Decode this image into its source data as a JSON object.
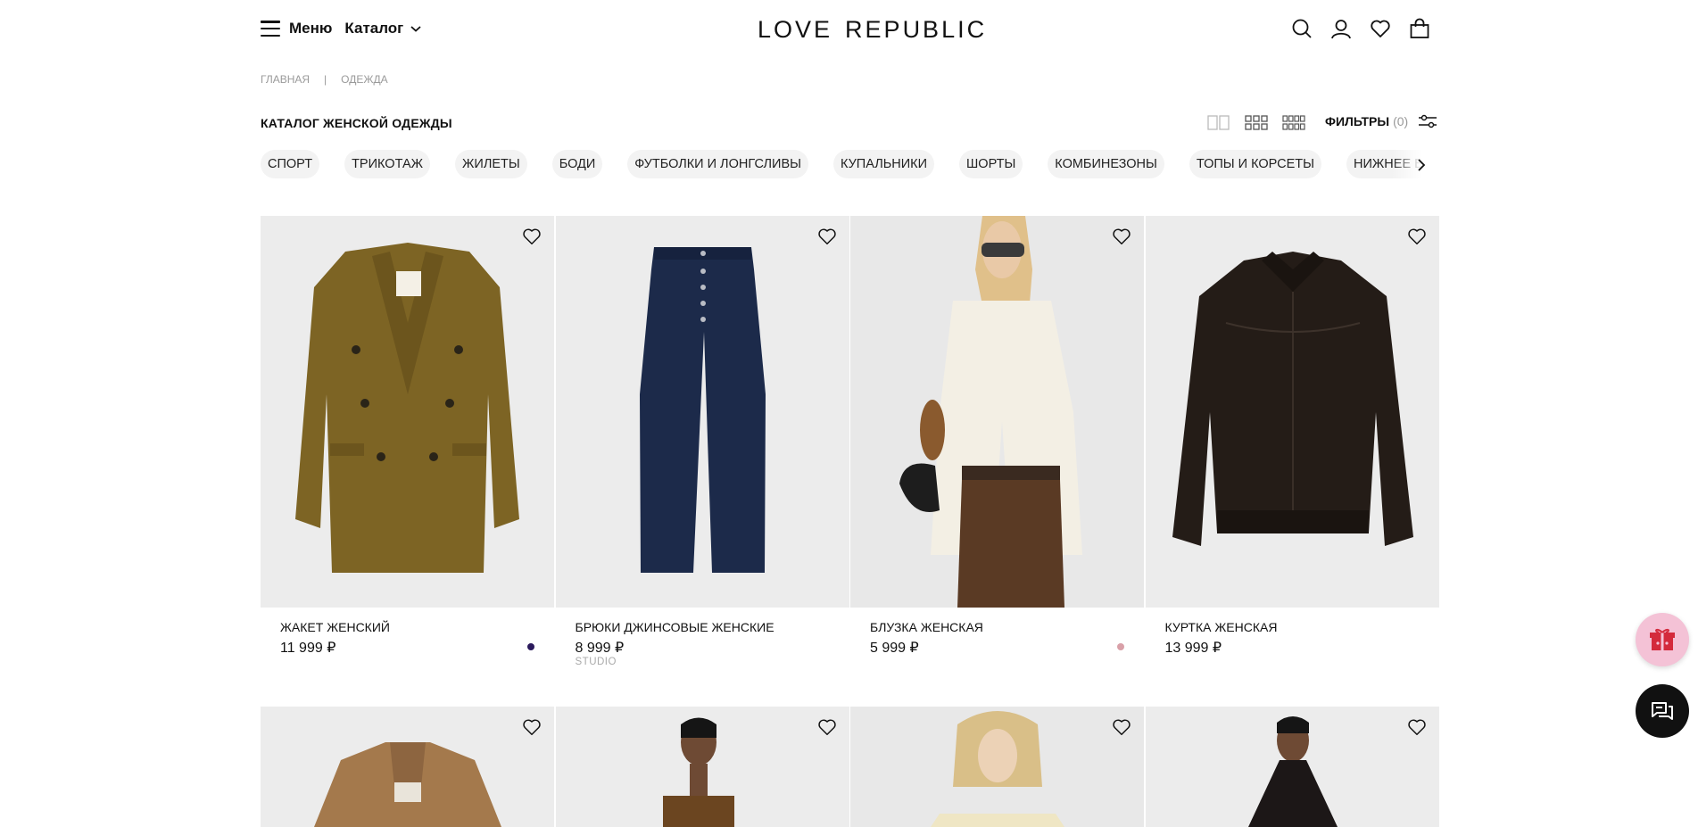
{
  "header": {
    "menu_label": "Меню",
    "catalog_label": "Каталог",
    "logo_left": "LOVE",
    "logo_right": "REPUBLIC",
    "icons": [
      "search-icon",
      "user-icon",
      "heart-icon",
      "bag-icon"
    ]
  },
  "breadcrumb": {
    "home": "ГЛАВНАЯ",
    "separator": "|",
    "current": "ОДЕЖДА"
  },
  "title": "КАТАЛОГ ЖЕНСКОЙ ОДЕЖДЫ",
  "filters": {
    "label": "ФИЛЬТРЫ",
    "count": "(0)"
  },
  "categories": [
    "СПОРТ",
    "ТРИКОТАЖ",
    "ЖИЛЕТЫ",
    "БОДИ",
    "ФУТБОЛКИ И ЛОНГСЛИВЫ",
    "КУПАЛЬНИКИ",
    "ШОРТЫ",
    "КОМБИНЕЗОНЫ",
    "ТОПЫ И КОРСЕТЫ",
    "НИЖНЕЕ БЕЛЬЕ И ДОМАШНЯЯ ОДЕЖДА"
  ],
  "products": [
    {
      "name": "ЖАКЕТ ЖЕНСКИЙ",
      "price": "11 999 ₽",
      "sub": "",
      "swatch": "#2b1a5c"
    },
    {
      "name": "БРЮКИ ДЖИНСОВЫЕ ЖЕНСКИЕ",
      "price": "8 999 ₽",
      "sub": "STUDIO",
      "swatch": ""
    },
    {
      "name": "БЛУЗКА ЖЕНСКАЯ",
      "price": "5 999 ₽",
      "sub": "",
      "swatch": "#d9a0a8"
    },
    {
      "name": "КУРТКА ЖЕНСКАЯ",
      "price": "13 999 ₽",
      "sub": "",
      "swatch": ""
    }
  ],
  "colors": {
    "photo_bg": "#ececec",
    "gift_bg": "#f4c2d6",
    "gift_icon": "#d42a3c",
    "chat_bg": "#111111"
  }
}
